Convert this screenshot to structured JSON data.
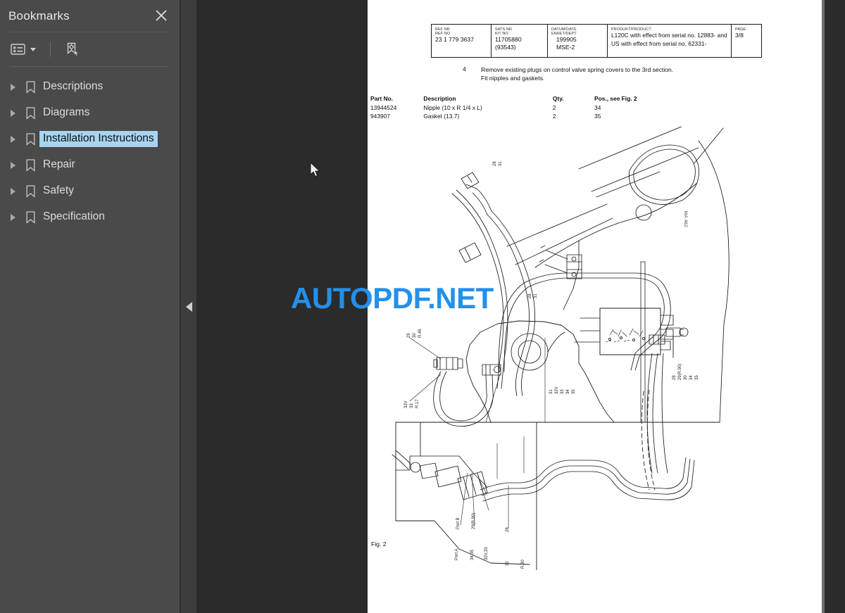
{
  "sidebar": {
    "title": "Bookmarks",
    "close_icon": "close-icon",
    "toolbar": {
      "list_options_icon": "list-options-icon",
      "list_options_caret": "chevron-down-icon",
      "new_bookmark_icon": "new-bookmark-icon"
    },
    "items": [
      {
        "label": "Descriptions",
        "selected": false,
        "expander": "chevron-right-icon",
        "icon": "bookmark-icon"
      },
      {
        "label": "Diagrams",
        "selected": false,
        "expander": "chevron-right-icon",
        "icon": "bookmark-icon"
      },
      {
        "label": "Installation Instructions",
        "selected": true,
        "expander": "chevron-right-icon",
        "icon": "bookmark-icon"
      },
      {
        "label": "Repair",
        "selected": false,
        "expander": "chevron-right-icon",
        "icon": "bookmark-icon"
      },
      {
        "label": "Safety",
        "selected": false,
        "expander": "chevron-right-icon",
        "icon": "bookmark-icon"
      },
      {
        "label": "Specification",
        "selected": false,
        "expander": "chevron-right-icon",
        "icon": "bookmark-icon"
      }
    ]
  },
  "collapse_handle": {
    "icon": "triangle-left-icon"
  },
  "document": {
    "header": {
      "ref": {
        "caption_line1": "REF NR",
        "caption_line2": "REF NO",
        "value": "23 1 779 3637"
      },
      "kit": {
        "caption_line1": "SATS NR",
        "caption_line2": "KIT NO",
        "value": "11705880",
        "value2": "(93543)"
      },
      "date": {
        "caption_line1": "DATUM/DATE",
        "caption_line2": "ENHET/DEPT",
        "value": "199905",
        "value2": "MSE-2"
      },
      "product": {
        "caption": "PRODUKT/PRODUCT",
        "value_line1": "L120C with effect from serial no. 12883- and",
        "value_line2": "US with effect from serial no. 62331-"
      },
      "page": {
        "caption": "PAGE",
        "value": "3/8"
      }
    },
    "step": {
      "number": "4",
      "line1": "Remove existing plugs on control valve spring covers to the 3rd section.",
      "line2": "Fit nipples and gaskets."
    },
    "parts": {
      "headers": [
        "Part No.",
        "Description",
        "Qty.",
        "Pos., see Fig. 2"
      ],
      "rows": [
        {
          "part_no": "13944524",
          "description": "Nipple (10 x R 1/4 x L)",
          "qty": "2",
          "pos": "34"
        },
        {
          "part_no": "943907",
          "description": "Gasket (13.7)",
          "qty": "2",
          "pos": "35"
        }
      ]
    },
    "figure_label": "Fig. 2",
    "drawing_code": "MA 462",
    "callouts": {
      "left_upper": "28",
      "left_mid_a": "29",
      "left_mid_b": "30",
      "left_lower": "32V, 33",
      "center_group": "31\n32V\n33\n34\n35",
      "right_group": "28\n29(R.90)\n30\n34\n35",
      "bottom_port_b": "Port B",
      "bottom_r90": "29(R.90)",
      "bottom_28": "28",
      "bottom_port_a": "Port A",
      "bottom_3435": "34,35",
      "bottom_32v33": "32V,33",
      "bottom_31": "31",
      "mid_hose_a": "R.30"
    }
  },
  "watermark": {
    "text": "AUTOPDF.NET",
    "color": "#2390ea"
  },
  "cursor": {
    "icon": "arrow-cursor-icon"
  }
}
